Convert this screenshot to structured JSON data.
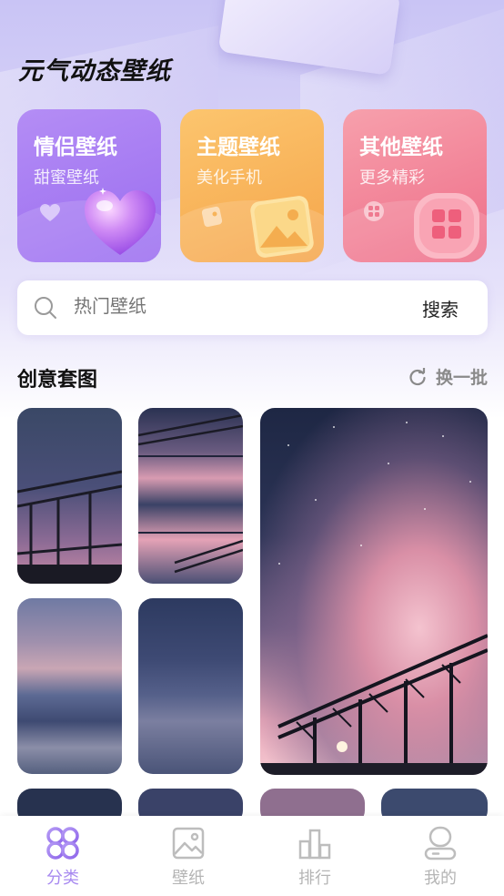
{
  "app": {
    "title": "元气动态壁纸"
  },
  "categories": [
    {
      "title": "情侣壁纸",
      "subtitle": "甜蜜壁纸"
    },
    {
      "title": "主题壁纸",
      "subtitle": "美化手机"
    },
    {
      "title": "其他壁纸",
      "subtitle": "更多精彩"
    }
  ],
  "search": {
    "placeholder": "热门壁纸",
    "button_label": "搜索"
  },
  "section": {
    "title": "创意套图",
    "refresh_label": "换一批"
  },
  "tabs": [
    {
      "label": "分类",
      "icon": "category-icon",
      "active": true
    },
    {
      "label": "壁纸",
      "icon": "image-icon",
      "active": false
    },
    {
      "label": "排行",
      "icon": "ranking-icon",
      "active": false
    },
    {
      "label": "我的",
      "icon": "profile-icon",
      "active": false
    }
  ],
  "colors": {
    "accent": "#a88af0",
    "card_couple": "#a57df2",
    "card_theme": "#f8b35c",
    "card_other": "#f2879a"
  }
}
